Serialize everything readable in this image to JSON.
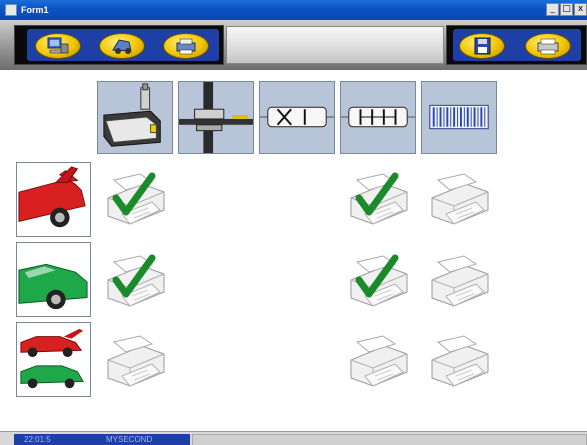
{
  "window": {
    "title": "Form1",
    "controls": {
      "minimize": "_",
      "restore": "□",
      "close": "x"
    }
  },
  "toolbar": {
    "left_buttons": [
      {
        "icon": "computer-icon"
      },
      {
        "icon": "car-part-icon"
      },
      {
        "icon": "printer-icon"
      }
    ],
    "right_buttons": [
      {
        "icon": "floppy-disk-icon"
      },
      {
        "icon": "printer-icon"
      }
    ]
  },
  "columns": [
    {
      "icon": "measuring-probe-icon"
    },
    {
      "icon": "track-gauge-icon"
    },
    {
      "icon": "cross-axis-icon"
    },
    {
      "icon": "wheel-axis-icon"
    },
    {
      "icon": "barcode-icon"
    }
  ],
  "rows": [
    {
      "icon": "red-car-hood-open-icon",
      "cells": [
        "printer-checked",
        "empty",
        "empty",
        "printer-checked",
        "printer"
      ]
    },
    {
      "icon": "green-car-icon",
      "cells": [
        "printer-checked",
        "empty",
        "empty",
        "printer-checked",
        "printer"
      ]
    },
    {
      "icon": "red-and-green-cars-icon",
      "cells": [
        "printer",
        "empty",
        "empty",
        "printer",
        "printer"
      ]
    }
  ],
  "status": {
    "time": "22:01:5",
    "name": "MYSECOND"
  },
  "colors": {
    "title_bar": "#0b55c8",
    "toolbar_blue": "#1d3fa6",
    "button_yellow": "#f0c400",
    "check_green": "#1a8a2a",
    "header_tile": "#b8c4d8"
  }
}
